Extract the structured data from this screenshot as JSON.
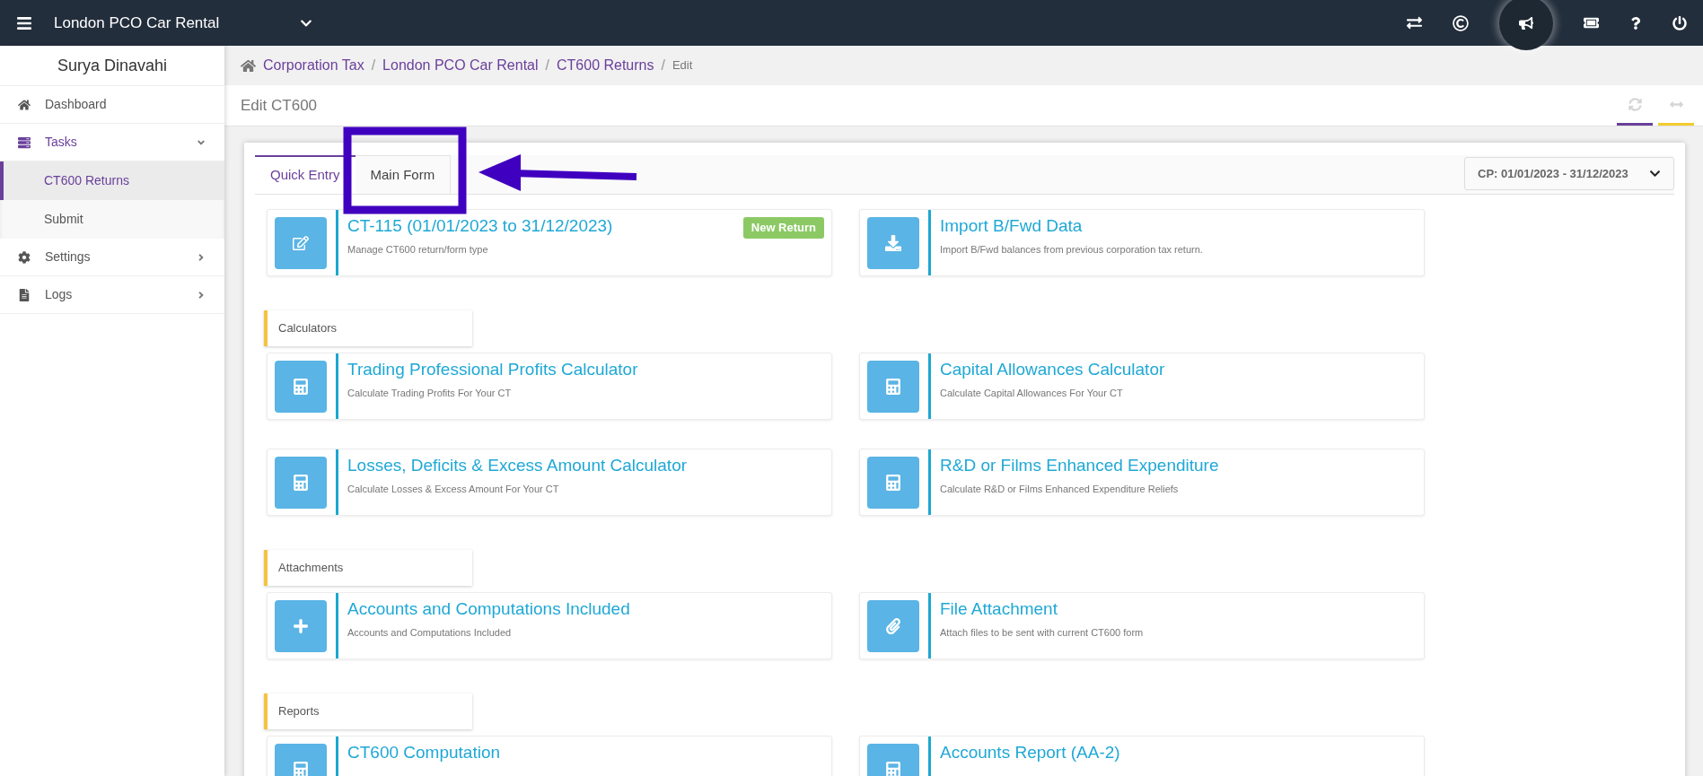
{
  "top_bar": {
    "company": "London PCO Car Rental"
  },
  "sidebar": {
    "user": "Surya Dinavahi",
    "items": [
      {
        "kind": "link",
        "label": "Dashboard",
        "selected": false
      },
      {
        "kind": "group",
        "label": "Tasks",
        "selected": true,
        "expanded": true,
        "children": [
          {
            "label": "CT600 Returns",
            "selected": true
          },
          {
            "label": "Submit",
            "selected": false
          }
        ]
      },
      {
        "kind": "group",
        "label": "Settings",
        "selected": false,
        "expanded": false
      },
      {
        "kind": "group",
        "label": "Logs",
        "selected": false,
        "expanded": false
      }
    ]
  },
  "breadcrumb": [
    {
      "kind": "link",
      "label": "Corporation Tax",
      "separator": "/"
    },
    {
      "kind": "link",
      "label": "London PCO Car Rental",
      "separator": "/"
    },
    {
      "kind": "link",
      "label": "CT600 Returns",
      "separator": "/"
    },
    {
      "kind": "current",
      "label": "Edit"
    }
  ],
  "page_title": "Edit CT600",
  "tabs": [
    {
      "label": "Quick Entry",
      "selected": true
    },
    {
      "label": "Main Form",
      "selected": false
    }
  ],
  "period_select": {
    "value": "CP: 01/01/2023 - 31/12/2023"
  },
  "sections": [
    {
      "cards": [
        {
          "title": "CT-115 (01/01/2023 to 31/12/2023)",
          "description": "Manage CT600 return/form type",
          "badge": "New Return"
        },
        {
          "title": "Import B/Fwd Data",
          "description": "Import B/Fwd balances from previous corporation tax return."
        }
      ]
    },
    {
      "heading": "Calculators",
      "cards": [
        {
          "title": "Trading Professional Profits Calculator",
          "description": "Calculate Trading Profits For Your CT"
        },
        {
          "title": "Capital Allowances Calculator",
          "description": "Calculate Capital Allowances For Your CT"
        },
        {
          "title": "Losses, Deficits & Excess Amount Calculator",
          "description": "Calculate Losses & Excess Amount For Your CT"
        },
        {
          "title": "R&D or Films Enhanced Expenditure",
          "description": "Calculate R&D or Films Enhanced Expenditure Reliefs"
        }
      ]
    },
    {
      "heading": "Attachments",
      "cards": [
        {
          "title": "Accounts and Computations Included",
          "description": "Accounts and Computations Included"
        },
        {
          "title": "File Attachment",
          "description": "Attach files to be sent with current CT600 form"
        }
      ]
    },
    {
      "heading": "Reports",
      "cards": [
        {
          "title": "CT600 Computation"
        },
        {
          "title": "Accounts Report (AA-2)"
        }
      ]
    }
  ]
}
